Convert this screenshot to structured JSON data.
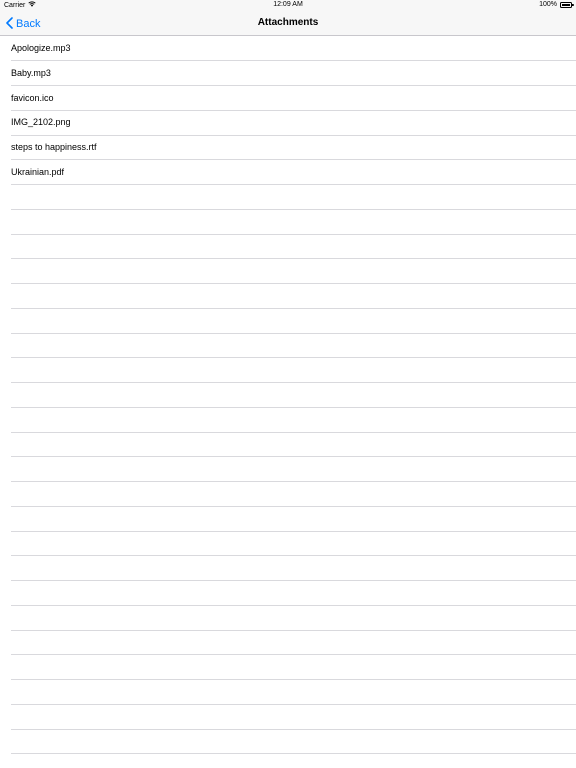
{
  "status_bar": {
    "carrier": "Carrier",
    "time": "12:09 AM",
    "battery_percent": "100%",
    "battery_level": 1.0,
    "wifi_icon": "wifi-icon",
    "battery_icon": "battery-icon"
  },
  "nav": {
    "back_label": "Back",
    "back_icon": "chevron-left-icon",
    "title": "Attachments",
    "accent_color": "#007aff"
  },
  "attachments": [
    "Apologize.mp3",
    "Baby.mp3",
    "favicon.ico",
    "IMG_2102.png",
    "steps to happiness.rtf",
    "Ukrainian.pdf"
  ]
}
